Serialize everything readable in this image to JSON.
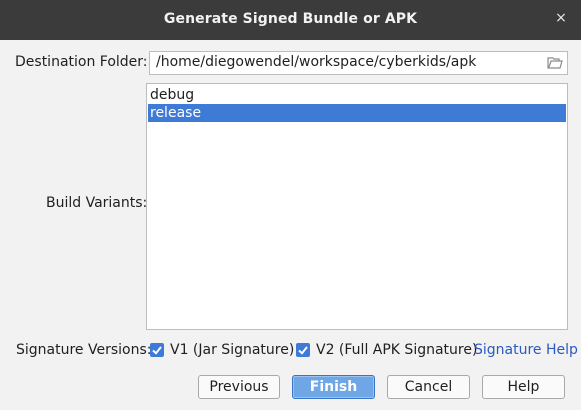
{
  "window": {
    "title": "Generate Signed Bundle or APK",
    "close_glyph": "×"
  },
  "destination": {
    "label": "Destination Folder:",
    "value": "/home/diegowendel/workspace/cyberkids/apk",
    "icon": "folder-icon"
  },
  "build_variants": {
    "label": "Build Variants:",
    "items": [
      {
        "label": "debug",
        "selected": false
      },
      {
        "label": "release",
        "selected": true
      }
    ]
  },
  "signature": {
    "label": "Signature Versions:",
    "v1_label": "V1 (Jar Signature)",
    "v1_checked": true,
    "v2_label": "V2 (Full APK Signature)",
    "v2_checked": true,
    "help_link": "Signature Help"
  },
  "buttons": {
    "previous": "Previous",
    "finish": "Finish",
    "cancel": "Cancel",
    "help": "Help"
  },
  "colors": {
    "titlebar": "#3b3b3b",
    "selection": "#3e7bd6",
    "link": "#2a59c0",
    "primary_button": "#6fa6e6"
  }
}
